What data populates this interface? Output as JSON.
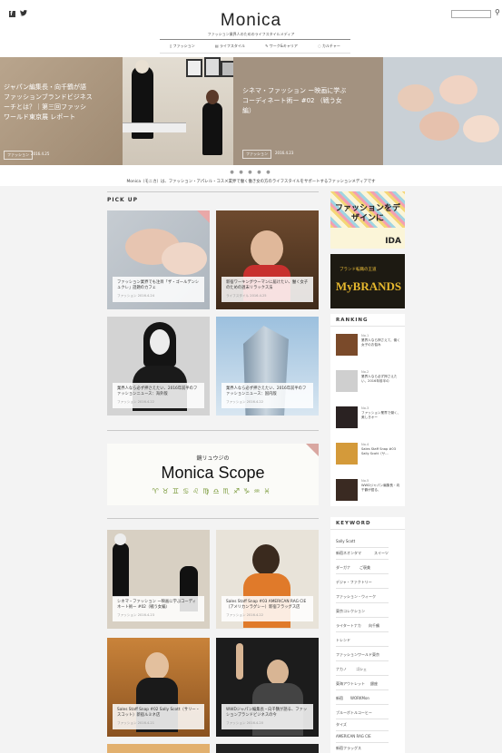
{
  "header": {
    "social": "f  ",
    "logo": "Monica",
    "tagline": "ファッション業界人のためのライフスタイルメディア",
    "nav": [
      "ファッション",
      "ライフスタイル",
      "ワーク&キャリア",
      "カルチャー"
    ]
  },
  "hero": {
    "left_caption": "ジャパン編集長・向千鶴が語\nファッションブランドビジネス\nーチとは？｜第三回ファッシ\nワールド東京展 レポート",
    "left_tag": "ファッション",
    "left_date": "2016.4.25",
    "center_caption": "シネマ・ファッション ー映画に学ぶ\nコーディネート術ー #02 （戦う女\n編）",
    "center_tag": "ファッション",
    "center_date": "2016.4.23"
  },
  "intro": "Monica（モニカ）は、ファッション・アパレル・コスメ業界で働く働き女の方のライフスタイルをサポートするファッションメディアです",
  "pickup": {
    "heading": "PICK UP",
    "cards": [
      {
        "title": "ファッション業界でも注目「ザ・ゴールデンシュクレ」話題のカフェ",
        "meta": "ファッション 2016.4.24"
      },
      {
        "title": "新宿ワーキングウーマンに届けたい、働く女子のための週末リラックス法",
        "meta": "ライフスタイル 2016.4.25"
      },
      {
        "title": "業界人なら必ず押さえたい、2016年前半のファッションニュース：海外版",
        "meta": "ファッション 2016.4.22"
      },
      {
        "title": "業界人なら必ず押さえたい、2016年前半のファッションニュース：国内版",
        "meta": "ファッション 2016.4.22"
      }
    ]
  },
  "banner": {
    "sub": "鏡リュウジの",
    "title": "Monica Scope",
    "icons": "♈♉♊♋♌♍♎♏♐♑♒♓"
  },
  "latest": {
    "cards": [
      {
        "title": "シネマ・ファッション ー映画に学ぶコーディネート術ー #02（戦う女編）",
        "meta": "ファッション 2016.4.23"
      },
      {
        "title": "Sales Staff Snap #03 AMERICAN RAG CIE（アメリカンラグシー）新宿フラッグス店",
        "meta": "ファッション 2016.4.22"
      },
      {
        "title": "Sales Staff Snap #02 Sally Scott（サリー・スコット）新宿ルミネ店",
        "meta": "ファッション 2016.4.21"
      },
      {
        "title": "WWDジャパン編集長・向千鶴が語る、ファッションブランドビジネスの今",
        "meta": "ファッション 2016.4.20"
      }
    ]
  },
  "sidebar": {
    "ad1_text": "ファッションをデザインに",
    "ad1_brand": "IDA",
    "ad2_text": "ブランド転職の王道",
    "ad2_brand": "MyBRANDS",
    "ranking_heading": "RANKING",
    "ranking": [
      {
        "no": "No.1",
        "title": "業界人なら押さえて、働く女子のお悩み"
      },
      {
        "no": "No.2",
        "title": "業界人なら必ず押さえたい、2016年前半の"
      },
      {
        "no": "No.3",
        "title": "ファッション業界で働く、美しきオー"
      },
      {
        "no": "No.4",
        "title": "Sales Staff Snap #03 Sally Scott（サ..."
      },
      {
        "no": "No.5",
        "title": "WWDジャパン編集長・向千鶴が語る、"
      }
    ],
    "keyword_heading": "KEYWORD",
    "keywords": [
      "Sally Scott",
      "新宿ネオンタマ",
      "スイーツ",
      "ダーガナ",
      "ご褒美",
      "デジャ・ファクトリー",
      "ファッション・ウィーク",
      "東京コレクション",
      "ライタートナカ",
      "向千鶴",
      "トレンド",
      "ファッションワールド東京",
      "ナカノ",
      "ゴシェ",
      "東海アウトレット",
      "銀座",
      "新宿",
      "WORKMon",
      "ブルーボトルコーヒー",
      "タイズ",
      "AMERICAN RAG CIE",
      "新宿フラッグス"
    ]
  }
}
